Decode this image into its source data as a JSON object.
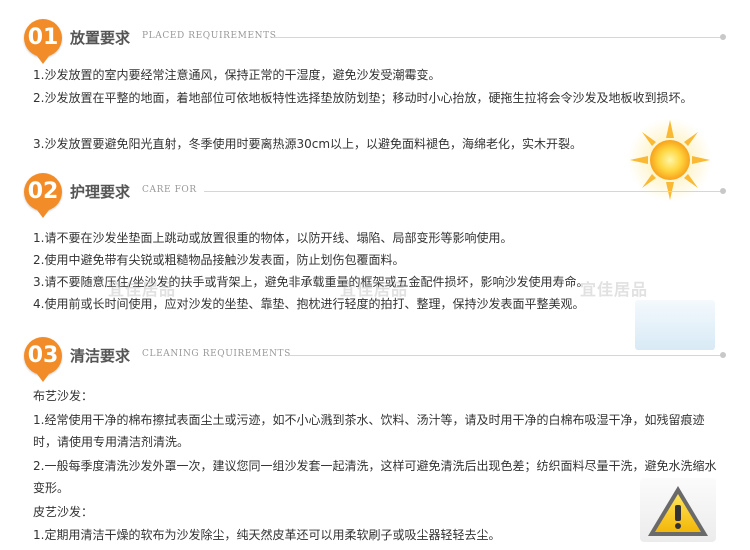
{
  "sections": [
    {
      "number": "01",
      "title_zh": "放置要求",
      "title_en": "PLACED REQUIREMENTS",
      "items": [
        "1.沙发放置的室内要经常注意通风，保持正常的干湿度，避免沙发受潮霉变。",
        "2.沙发放置在平整的地面，着地部位可依地板特性选择垫放防划垫；移动时小心抬放，硬拖生拉将会令沙发及地板收到损坏。",
        "3.沙发放置要避免阳光直射，冬季使用时要离热源30cm以上，以避免面料褪色，海绵老化，实木开裂。"
      ]
    },
    {
      "number": "02",
      "title_zh": "护理要求",
      "title_en": "CARE FOR",
      "items": [
        "1.请不要在沙发坐垫面上跳动或放置很重的物体，以防开线、塌陷、局部变形等影响使用。",
        "2.使用中避免带有尖锐或粗糙物品接触沙发表面，防止划伤包覆面料。",
        "3.请不要随意压住/坐沙发的扶手或背架上，避免非承载重量的框架或五金配件损坏，影响沙发使用寿命。",
        "4.使用前或长时间使用，应对沙发的坐垫、靠垫、抱枕进行轻度的拍打、整理，保持沙发表面平整美观。"
      ]
    },
    {
      "number": "03",
      "title_zh": "清洁要求",
      "title_en": "CLEANING REQUIREMENTS",
      "items": [
        "布艺沙发：",
        "1.经常使用干净的棉布擦拭表面尘土或污迹，如不小心溅到茶水、饮料、汤汁等，请及时用干净的白棉布吸湿干净，如残留痕迹时，请使用专用清洁剂清洗。",
        "2.一般每季度清洗沙发外罩一次，建议您同一组沙发套一起清洗，这样可避免清洗后出现色差；纺织面料尽量干洗，避免水洗缩水变形。",
        "皮艺沙发：",
        "1.定期用清洁干燥的软布为沙发除尘，纯天然皮革还可以用柔软刷子或吸尘器轻轻去尘。"
      ]
    }
  ],
  "watermark": "宜佳居品",
  "colors": {
    "accent": "#f28c28",
    "text": "#333333",
    "rule": "#d6d6d6"
  },
  "icons": {
    "sun": "sun-icon",
    "water": "water-droplet-icon",
    "warning": "warning-icon"
  }
}
